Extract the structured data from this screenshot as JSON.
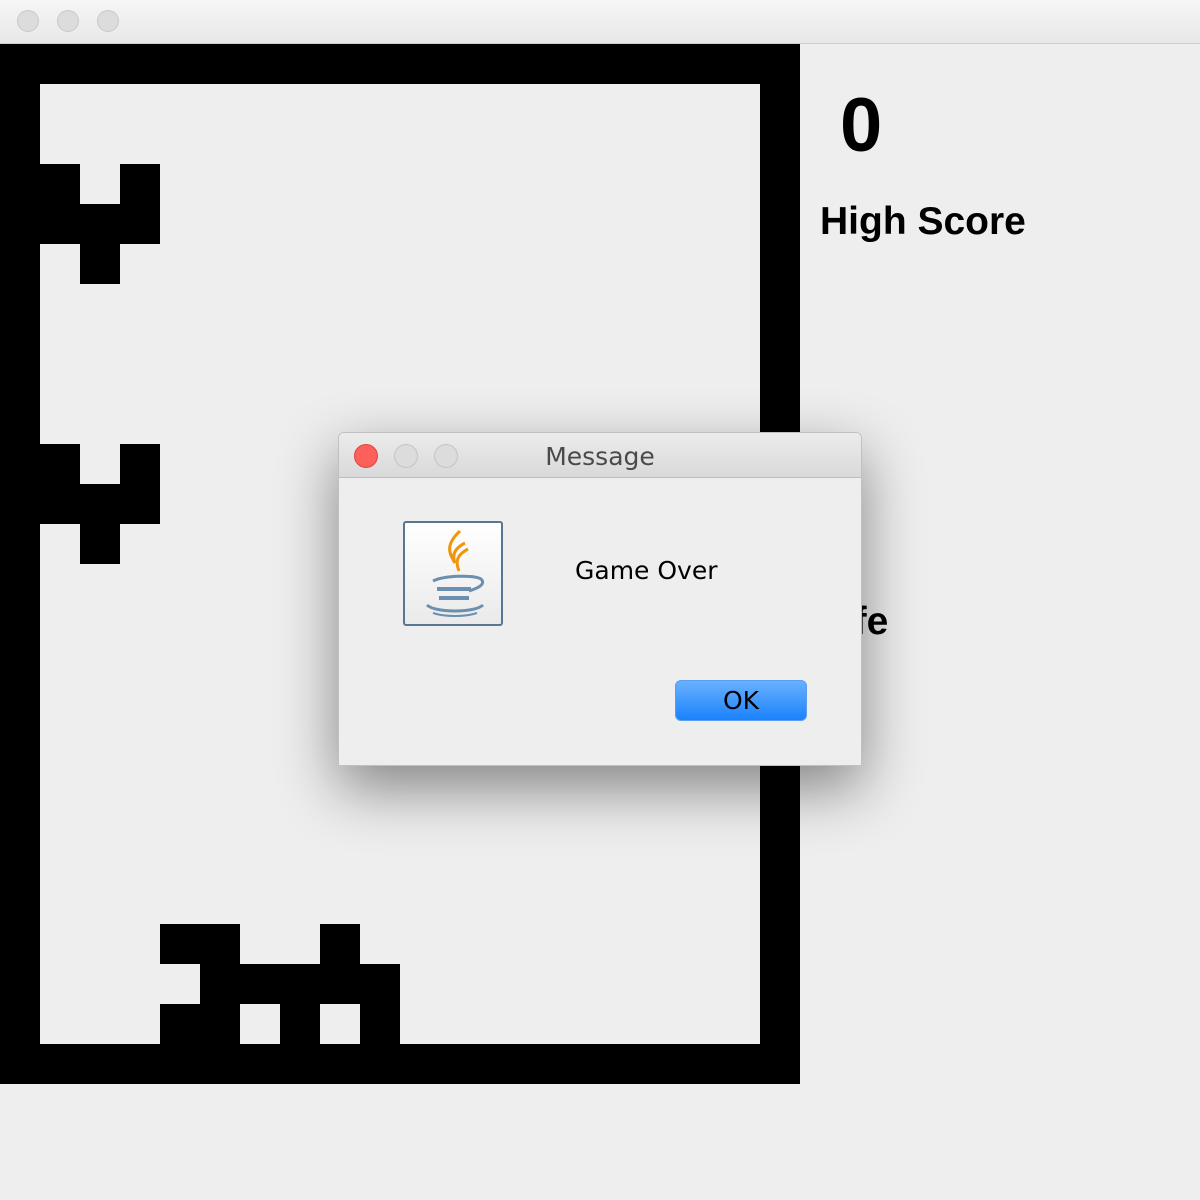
{
  "window": {
    "title": ""
  },
  "board": {
    "rows": [
      "..................",
      "..................",
      "#.#...............",
      "###...............",
      ".#................",
      "..................",
      "..................",
      "..................",
      "..................",
      "#.#...............",
      "###...............",
      ".#................",
      "..................",
      "..................",
      "..................",
      "..................",
      "..................",
      "..................",
      "..................",
      "..................",
      "..................",
      "...##..#..........",
      "....#####.........",
      "...##.#.#........."
    ]
  },
  "panel": {
    "score": "0",
    "high_score_label": "High Score",
    "life_label": "Life"
  },
  "dialog": {
    "title": "Message",
    "icon": "java-coffee-cup-icon",
    "message": "Game Over",
    "ok_label": "OK",
    "close_color": "#fc605b",
    "ok_color": "#1a82fb"
  }
}
